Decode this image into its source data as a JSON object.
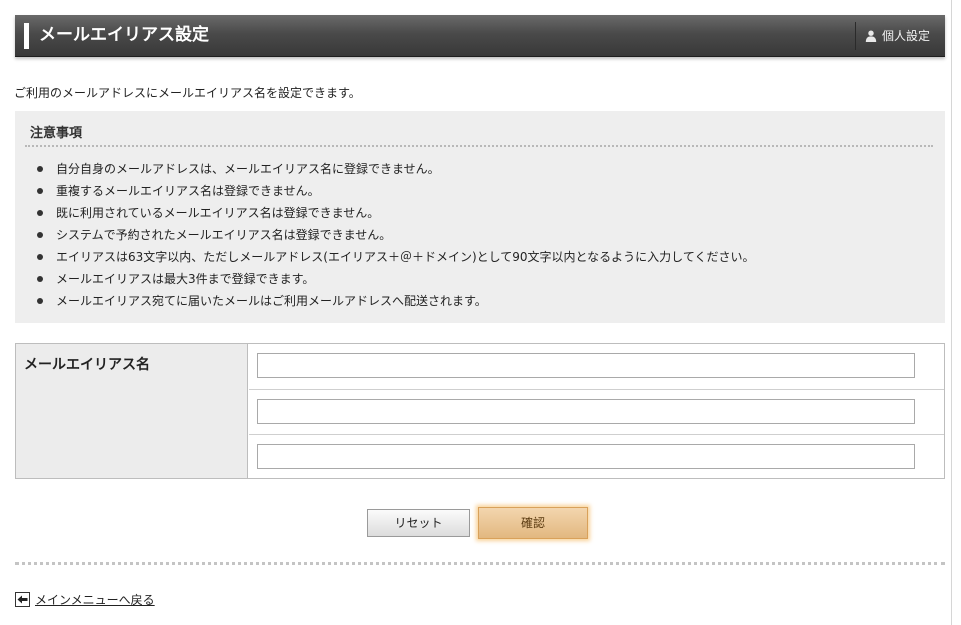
{
  "header": {
    "title": "メールエイリアス設定",
    "user_link_label": "個人設定",
    "user_icon": "person-icon"
  },
  "intro": "ご利用のメールアドレスにメールエイリアス名を設定できます。",
  "notes": {
    "title": "注意事項",
    "items": [
      "自分自身のメールアドレスは、メールエイリアス名に登録できません。",
      "重複するメールエイリアス名は登録できません。",
      "既に利用されているメールエイリアス名は登録できません。",
      "システムで予約されたメールエイリアス名は登録できません。",
      "エイリアスは63文字以内、ただしメールアドレス(エイリアス＋＠＋ドメイン)として90文字以内となるように入力してください。",
      "メールエイリアスは最大3件まで登録できます。",
      "メールエイリアス宛てに届いたメールはご利用メールアドレスへ配送されます。"
    ]
  },
  "form": {
    "label": "メールエイリアス名",
    "fields": [
      {
        "value": ""
      },
      {
        "value": ""
      },
      {
        "value": ""
      }
    ]
  },
  "buttons": {
    "reset": "リセット",
    "confirm": "確認"
  },
  "footer": {
    "back_link": "メインメニューへ戻る",
    "back_icon": "arrow-left-icon"
  },
  "colors": {
    "header_bg": "#4a4a4a",
    "notes_bg": "#eeeeee",
    "confirm_bg": "#e8c08c",
    "confirm_glow": "#f7c478"
  }
}
